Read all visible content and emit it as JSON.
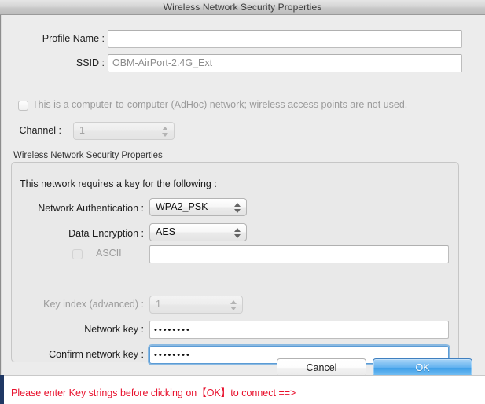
{
  "window": {
    "title": "Wireless Network Security Properties"
  },
  "form": {
    "profile_name_label": "Profile Name :",
    "profile_name_value": "",
    "profile_name_placeholder": "",
    "ssid_label": "SSID :",
    "ssid_value": "OBM-AirPort-2.4G_Ext",
    "adhoc_label": "This is a computer-to-computer (AdHoc) network; wireless access points are not used.",
    "adhoc_checked": false,
    "channel_label": "Channel :",
    "channel_value": "1"
  },
  "group": {
    "title": "Wireless Network Security Properties",
    "intro": "This network requires a key for the following :",
    "network_auth_label": "Network Authentication :",
    "network_auth_value": "WPA2_PSK",
    "network_auth_options": [
      "WPA2_PSK"
    ],
    "data_encryption_label": "Data Encryption :",
    "data_encryption_value": "AES",
    "data_encryption_options": [
      "AES"
    ],
    "ascii_label": "ASCII",
    "ascii_checked": false,
    "ascii_value": "",
    "key_index_label": "Key index (advanced) :",
    "key_index_value": "1",
    "network_key_label": "Network key :",
    "network_key_value": "••••••••",
    "confirm_key_label": "Confirm network key :",
    "confirm_key_value": "••••••••"
  },
  "buttons": {
    "cancel": "Cancel",
    "ok": "OK"
  },
  "status": {
    "message": "Please enter Key strings before clicking on【OK】to connect ==>",
    "color": "#e8112d"
  }
}
